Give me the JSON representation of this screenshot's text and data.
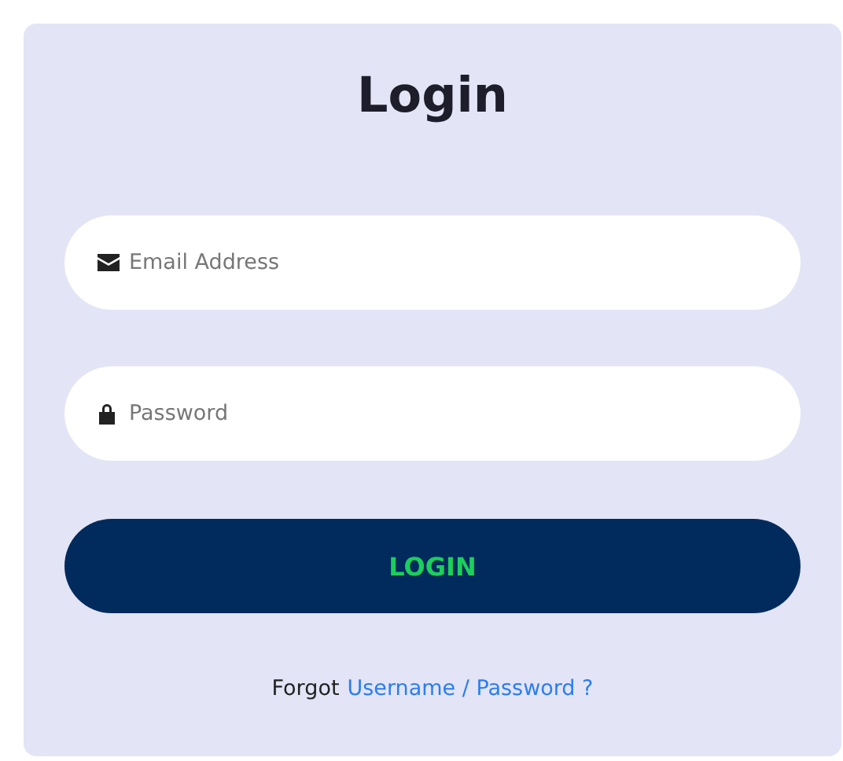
{
  "title": "Login",
  "fields": [
    {
      "kind": "email",
      "placeholder": "Email Address"
    },
    {
      "kind": "password",
      "placeholder": "Password"
    }
  ],
  "button": "LOGIN",
  "forgot": {
    "text": "Forgot",
    "link": "Username / Password ?"
  }
}
